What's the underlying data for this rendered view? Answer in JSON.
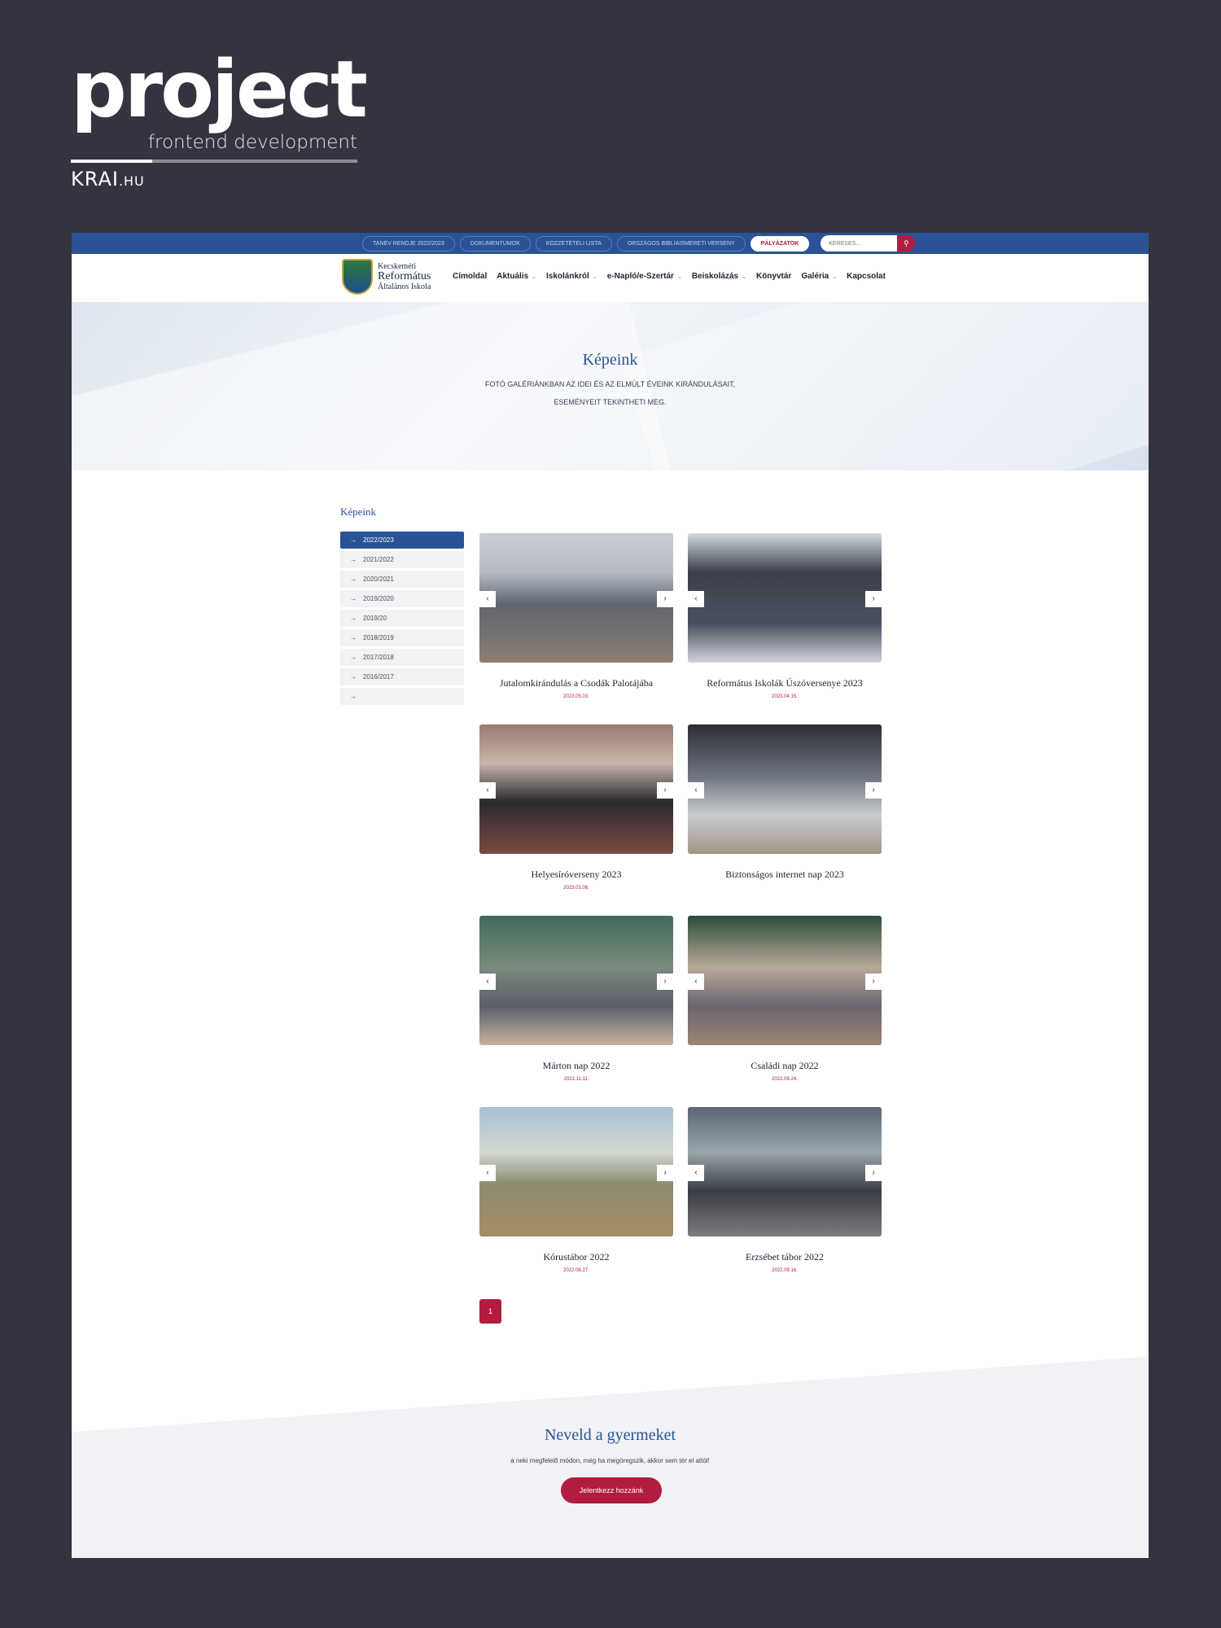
{
  "branding": {
    "logo": "project",
    "subtitle": "frontend development",
    "krai_main": "KRAI",
    "krai_suffix": ".HU"
  },
  "topbar": {
    "links": [
      "TANÉV RENDJE 2022/2023",
      "DOKUMENTUMOK",
      "KÖZZÉTÉTELI LISTA",
      "ORSZÁGOS BIBLIAISMERETI VERSENY",
      "PÁLYÁZATOK"
    ],
    "search_placeholder": "KERESÉS...",
    "search_icon": "search-icon"
  },
  "school": {
    "line1": "Kecskeméti",
    "line2": "Református",
    "line3": "Általános Iskola"
  },
  "menu": [
    "Címoldal",
    "Aktuális",
    "Iskolánkról",
    "e-Napló/e-Szertár",
    "Beiskolázás",
    "Könyvtár",
    "Galéria",
    "Kapcsolat"
  ],
  "hero": {
    "title": "Képeink",
    "text": "FOTÓ GALÉRIÁNKBAN AZ IDEI ÉS AZ ELMÚLT ÉVEINK KIRÁNDULÁSAIT, ESEMÉNYEIT TEKINTHETI MEG."
  },
  "sidebar": {
    "title": "Képeink",
    "items": [
      "2022/2023",
      "2021/2022",
      "2020/2021",
      "2019/2020",
      "2019/20",
      "2018/2019",
      "2017/2018",
      "2016/2017",
      ""
    ]
  },
  "gallery": [
    {
      "title": "Jutalomkirándulás a Csodák Palotájába",
      "date": "2023.05.03."
    },
    {
      "title": "Református Iskolák Úszóversenye 2023",
      "date": "2023.04.15."
    },
    {
      "title": "Helyesíróverseny 2023",
      "date": "2023.03.06."
    },
    {
      "title": "Biztonságos internet nap 2023",
      "date": ""
    },
    {
      "title": "Márton nap 2022",
      "date": "2022.11.11."
    },
    {
      "title": "Családi nap 2022",
      "date": "2022.09.24."
    },
    {
      "title": "Kórustábor 2022",
      "date": "2022.08.27."
    },
    {
      "title": "Erzsébet tábor 2022",
      "date": "2022.09.16."
    }
  ],
  "pagination": {
    "current": "1"
  },
  "cta": {
    "title": "Neveld a gyermeket",
    "text": "a neki megfelelő módon, még ha megöregszik, akkor sem tér el attól!",
    "button": "Jelentkezz hozzánk"
  },
  "colors": {
    "primary": "#2a5296",
    "accent": "#b31c3f",
    "background": "#33343f"
  }
}
